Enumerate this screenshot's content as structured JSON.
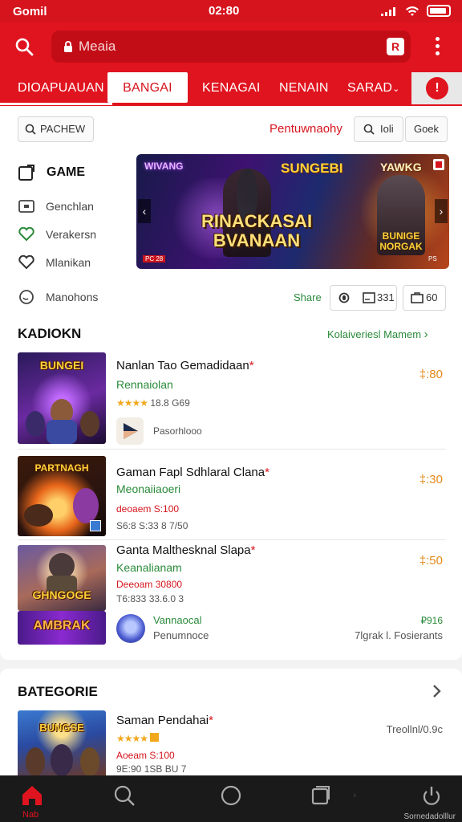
{
  "status_bar": {
    "carrier": "Gomil",
    "time": "02:80"
  },
  "header": {
    "search_placeholder": "Meaia",
    "qr_label": "R"
  },
  "tabs": [
    {
      "label": "DIOAPUAUAN"
    },
    {
      "label": "BANGAI"
    },
    {
      "label": "KENAGAI"
    },
    {
      "label": "NENAIN"
    },
    {
      "label": "SARAD"
    }
  ],
  "tab_avatar": "!",
  "filters": {
    "chip1": "PACHEW",
    "promo_link": "Pentuwnaohy",
    "chip2": "Ioli",
    "chip3": "Goek"
  },
  "sidebar": {
    "title": "GAME",
    "items": [
      {
        "label": "Genchlan",
        "icon": "folder-icon"
      },
      {
        "label": "Verakersn",
        "icon": "heart-icon"
      },
      {
        "label": "Mlanikan",
        "icon": "heart-outline-icon"
      },
      {
        "label": "Manohons",
        "icon": "chat-icon"
      }
    ]
  },
  "banner": {
    "logo_left": "WIVANG",
    "logo_mid": "SUNGEBI",
    "logo_right": "YAWKG",
    "title_line1": "RINACKASAI",
    "title_line2": "BVANAAN",
    "sub_title_line1": "BUNIGE",
    "sub_title_line2": "NORGAK",
    "tag": "PC 28",
    "tag_right": "PS"
  },
  "share": {
    "label": "Share",
    "count1": "331",
    "count2": "60"
  },
  "section1": {
    "title": "KADIOKN",
    "more": "Kolaiveriesl Mamem",
    "games": [
      {
        "title": "Nanlan Tao Gemadidaan",
        "dev": "Rennaiolan",
        "stars": "★★★★",
        "meta": "18.8 G69",
        "price": "‡:80",
        "publisher": "Pasorhlooo",
        "thumb_logo": "BUNGEI",
        "colors": [
          "#3a1a6a",
          "#a84aff",
          "#2a1040"
        ]
      },
      {
        "title": "Gaman Fapl Sdhlaral Clana",
        "dev": "Meonaiiaoeri",
        "red": "deoaem S:100",
        "meta": "S6:8 S:33 8 7/50",
        "price": "‡:30",
        "thumb_logo": "PARTNAGH",
        "colors": [
          "#2a1208",
          "#e86a1a",
          "#3a2010"
        ]
      },
      {
        "title": "Ganta Malthesknal Slapa",
        "dev": "Keanalianam",
        "red": "Deeoam 30800",
        "meta": "T6:833 33.6.0 3",
        "price": "‡:50",
        "thumb_logo": "GHNGOGE",
        "logo2": "AMBRAK",
        "sub_dev": "Vannaocal",
        "sub_pub": "Penumnoce",
        "sub_price": "₽916",
        "sub_meta": "7lgrak l. Fosierants",
        "colors": [
          "#6a4aa0",
          "#e8b43a",
          "#3a1a50"
        ]
      }
    ]
  },
  "section2": {
    "title": "BATEGORIE",
    "game": {
      "title": "Saman Pendahai",
      "stars": "★★★★",
      "red": "Aoeam S:100",
      "meta": "9E:90 1SB BU 7",
      "right_meta": "Treollnl/0.9c",
      "thumb_logo": "BUNGSE"
    }
  },
  "navbar": {
    "home_label": "Nab",
    "caption": "Sornedadolllur"
  },
  "colors": {
    "brand": "#e0141f",
    "green": "#2a8a3a",
    "price": "#e5891a"
  }
}
